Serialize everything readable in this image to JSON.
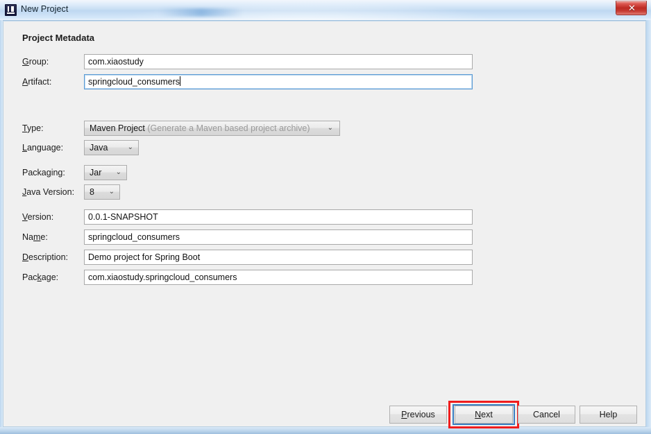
{
  "window": {
    "title": "New Project",
    "icon": "intellij-idea-icon",
    "close_label": "✕",
    "accent_blue": "#3a7fc1",
    "annotation_red": "#f01d1d",
    "dialog_bg": "#f0f0f0"
  },
  "page": {
    "heading": "Project Metadata"
  },
  "fields": [
    {
      "id": "group",
      "label": "Group:",
      "mnemonic": "G",
      "value": "com.xiaostudy",
      "type": "text",
      "focused": false
    },
    {
      "id": "artifact",
      "label": "Artifact:",
      "mnemonic": "A",
      "value": "springcloud_consumers",
      "type": "text",
      "focused": true
    },
    {
      "id": "type",
      "label": "Type:",
      "mnemonic": "T",
      "value": "Maven Project",
      "hint": "(Generate a Maven based project archive)",
      "type": "combo"
    },
    {
      "id": "language",
      "label": "Language:",
      "mnemonic": "L",
      "value": "Java",
      "type": "combo"
    },
    {
      "id": "packaging",
      "label": "Packaging:",
      "mnemonic": "g",
      "value": "Jar",
      "type": "combo"
    },
    {
      "id": "java-version",
      "label": "Java Version:",
      "mnemonic": "J",
      "value": "8",
      "type": "combo"
    },
    {
      "id": "version",
      "label": "Version:",
      "mnemonic": "V",
      "value": "0.0.1-SNAPSHOT",
      "type": "text",
      "focused": false
    },
    {
      "id": "name",
      "label": "Name:",
      "mnemonic": "m",
      "value": "springcloud_consumers",
      "type": "text",
      "focused": false
    },
    {
      "id": "description",
      "label": "Description:",
      "mnemonic": "D",
      "value": "Demo project for Spring Boot",
      "type": "text",
      "focused": false
    },
    {
      "id": "package",
      "label": "Package:",
      "mnemonic": "k",
      "value": "com.xiaostudy.springcloud_consumers",
      "type": "text",
      "focused": false
    }
  ],
  "labels": {
    "group": {
      "pre": "",
      "mn": "G",
      "post": "roup:"
    },
    "artifact": {
      "pre": "",
      "mn": "A",
      "post": "rtifact:"
    },
    "type": {
      "pre": "",
      "mn": "T",
      "post": "ype:"
    },
    "language": {
      "pre": "",
      "mn": "L",
      "post": "anguage:"
    },
    "packaging": {
      "pre": "Packa",
      "mn": "g",
      "post": "ing:"
    },
    "javaversion": {
      "pre": "",
      "mn": "J",
      "post": "ava Version:"
    },
    "version": {
      "pre": "",
      "mn": "V",
      "post": "ersion:"
    },
    "name": {
      "pre": "Na",
      "mn": "m",
      "post": "e:"
    },
    "description": {
      "pre": "",
      "mn": "D",
      "post": "escription:"
    },
    "package": {
      "pre": "Pac",
      "mn": "k",
      "post": "age:"
    }
  },
  "combo_values": {
    "type_value": "Maven Project",
    "type_hint": "(Generate a Maven based project archive)",
    "language": "Java",
    "packaging": "Jar",
    "java_version": "8",
    "arrow_glyph": "⌄"
  },
  "buttons": {
    "previous": {
      "pre": "",
      "mn": "P",
      "post": "revious"
    },
    "next": {
      "pre": "",
      "mn": "N",
      "post": "ext"
    },
    "cancel": {
      "pre": "Cancel",
      "mn": "",
      "post": ""
    },
    "help": {
      "pre": "Help",
      "mn": "",
      "post": ""
    }
  }
}
